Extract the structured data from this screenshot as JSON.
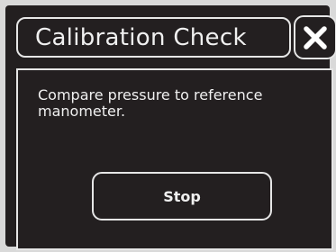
{
  "dialog": {
    "title": "Calibration Check",
    "message": "Compare pressure to reference manometer.",
    "close_icon": "close-icon",
    "stop_label": "Stop"
  },
  "colors": {
    "background": "#231f20",
    "border": "#e6e6e6",
    "text": "#f0f0f0"
  }
}
